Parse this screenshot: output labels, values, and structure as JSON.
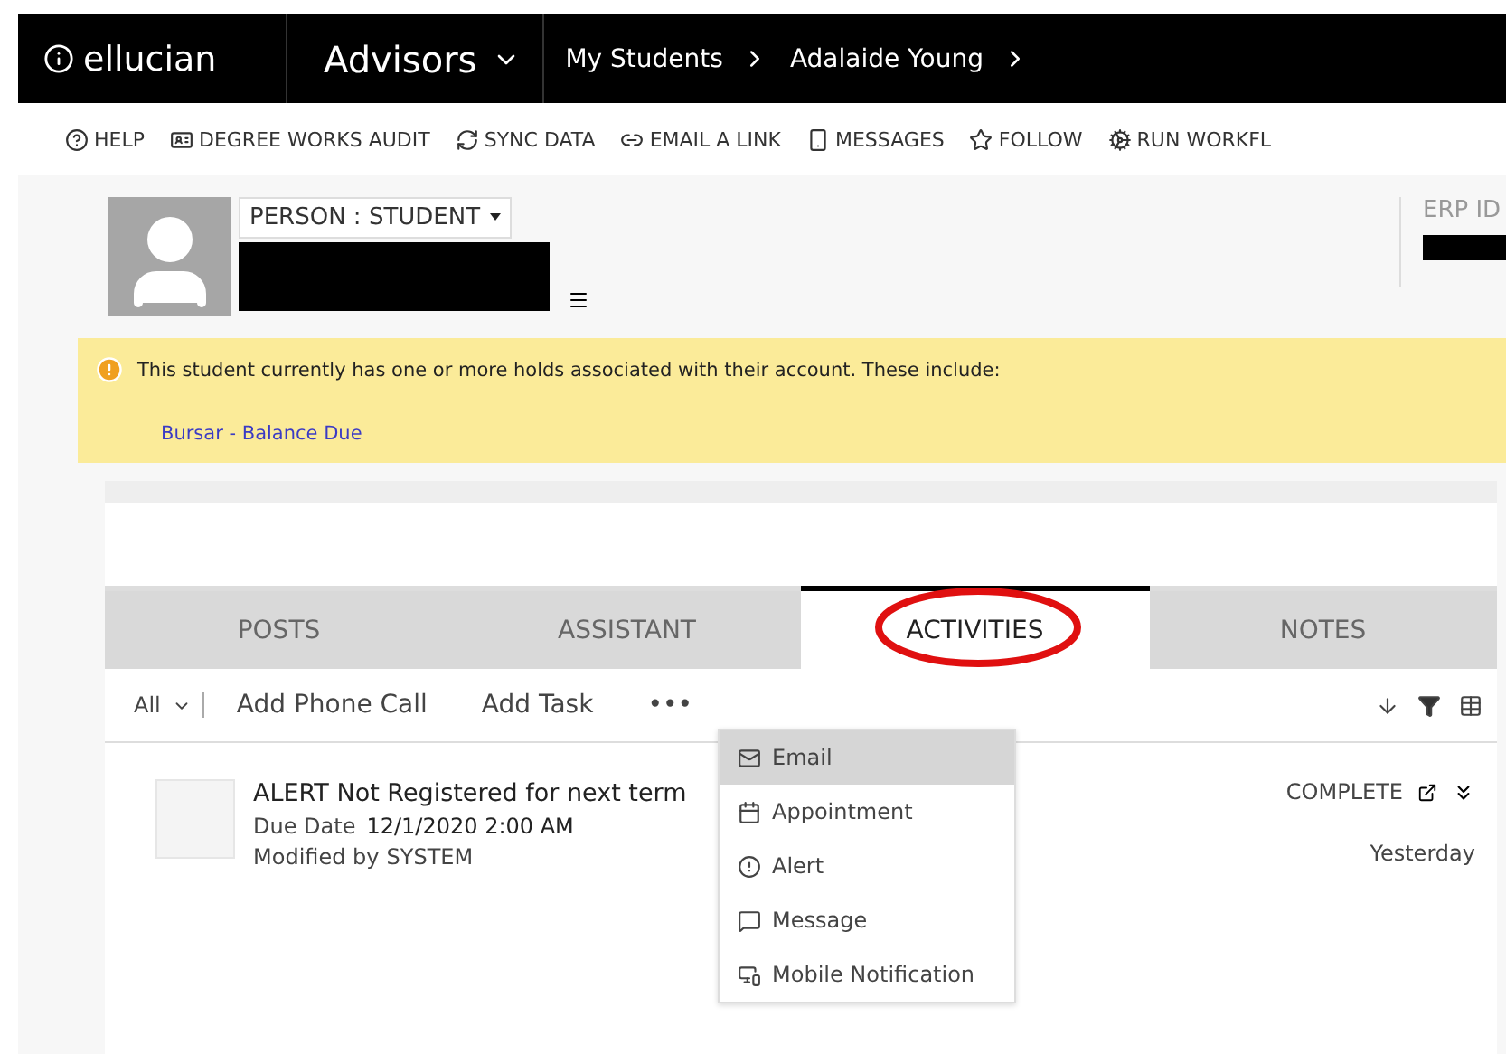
{
  "topbar": {
    "brand": "ellucian",
    "app": "Advisors",
    "breadcrumbs": [
      "My Students",
      "Adalaide Young"
    ]
  },
  "toolbar": [
    {
      "label": "HELP",
      "kind": "help"
    },
    {
      "label": "DEGREE WORKS AUDIT",
      "kind": "audit"
    },
    {
      "label": "SYNC DATA",
      "kind": "sync"
    },
    {
      "label": "EMAIL A LINK",
      "kind": "link"
    },
    {
      "label": "MESSAGES",
      "kind": "phone"
    },
    {
      "label": "FOLLOW",
      "kind": "star"
    },
    {
      "label": "RUN WORKFL",
      "kind": "workflow"
    }
  ],
  "record": {
    "form": "PERSON : STUDENT",
    "erp_label": "ERP ID"
  },
  "holds_banner": {
    "message": "This student currently has one or more holds associated with their account. These include:",
    "hold": "Bursar - Balance Due"
  },
  "tabs": [
    {
      "label": "POSTS",
      "selected": false
    },
    {
      "label": "ASSISTANT",
      "selected": false
    },
    {
      "label": "ACTIVITIES",
      "selected": true,
      "circled": true
    },
    {
      "label": "NOTES",
      "selected": false
    }
  ],
  "activity_bar": {
    "filter": "All",
    "actions": [
      "Add Phone Call",
      "Add Task"
    ],
    "more": "•••"
  },
  "activity": {
    "title": "ALERT Not Registered for next term",
    "due_label": "Due Date",
    "due": "12/1/2020 2:00 AM",
    "modified_label": "Modified by",
    "modified_by": "SYSTEM",
    "action": "COMPLETE",
    "when": "Yesterday"
  },
  "menu": [
    {
      "label": "Email",
      "kind": "email",
      "selected": true
    },
    {
      "label": "Appointment",
      "kind": "appointment",
      "selected": false
    },
    {
      "label": "Alert",
      "kind": "alert",
      "selected": false
    },
    {
      "label": "Message",
      "kind": "message",
      "selected": false
    },
    {
      "label": "Mobile Notification",
      "kind": "mobile",
      "selected": false
    }
  ]
}
